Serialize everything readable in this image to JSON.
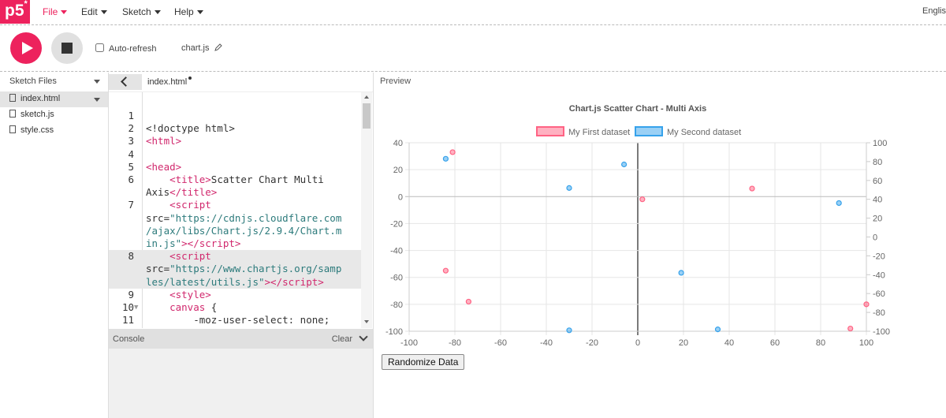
{
  "nav": {
    "logo": "p5",
    "logo_sup": "*",
    "menus": [
      "File",
      "Edit",
      "Sketch",
      "Help"
    ],
    "language": "Englis"
  },
  "toolbar": {
    "auto_refresh_label": "Auto-refresh",
    "sketch_name": "chart.js"
  },
  "sidebar": {
    "title": "Sketch Files",
    "files": [
      "index.html",
      "sketch.js",
      "style.css"
    ]
  },
  "editor": {
    "tab_file": "index.html"
  },
  "console": {
    "title": "Console",
    "clear_label": "Clear"
  },
  "preview": {
    "label": "Preview",
    "randomize_label": "Randomize Data"
  },
  "colors": {
    "accent": "#ed225d",
    "dataset1": "#ff6384",
    "dataset2": "#36a2eb"
  },
  "chart_data": {
    "type": "scatter",
    "title": "Chart.js Scatter Chart - Multi Axis",
    "legend_position": "top",
    "grid": true,
    "x_axis": {
      "min": -100,
      "max": 100,
      "ticks": [
        "-100",
        "-80",
        "-60",
        "-40",
        "-20",
        "0",
        "20",
        "40",
        "60",
        "80",
        "100"
      ]
    },
    "y_left": {
      "min": -100,
      "max": 40,
      "ticks": [
        "40",
        "20",
        "0",
        "-20",
        "-40",
        "-60",
        "-80",
        "-100"
      ]
    },
    "y_right": {
      "min": -100,
      "max": 100,
      "ticks": [
        "100",
        "80",
        "60",
        "40",
        "20",
        "0",
        "-20",
        "-40",
        "-60",
        "-80",
        "-100"
      ]
    },
    "series": [
      {
        "name": "My First dataset",
        "axis": "left",
        "points": [
          [
            -81,
            33
          ],
          [
            -84,
            -55
          ],
          [
            -74,
            -78
          ],
          [
            2,
            -2
          ],
          [
            50,
            6
          ],
          [
            93,
            -98
          ],
          [
            100,
            -80
          ]
        ]
      },
      {
        "name": "My Second dataset",
        "axis": "right",
        "points": [
          [
            -84,
            83
          ],
          [
            -6,
            77
          ],
          [
            -30,
            52
          ],
          [
            88,
            36
          ],
          [
            19,
            -38
          ],
          [
            -30,
            -99
          ],
          [
            35,
            -98
          ]
        ]
      }
    ]
  },
  "code_lines": [
    {
      "n": "1",
      "hl": false,
      "html": ""
    },
    {
      "n": "2",
      "hl": false,
      "html": "&lt;!doctype html&gt;"
    },
    {
      "n": "3",
      "hl": false,
      "html": "<span class=\"t\">&lt;html&gt;</span>"
    },
    {
      "n": "4",
      "hl": false,
      "html": ""
    },
    {
      "n": "5",
      "hl": false,
      "html": "<span class=\"t\">&lt;head&gt;</span>"
    },
    {
      "n": "6",
      "hl": false,
      "html": "    <span class=\"t\">&lt;title&gt;</span>Scatter Chart Multi"
    },
    {
      "n": "",
      "hl": false,
      "html": "Axis<span class=\"t\">&lt;/title&gt;</span>"
    },
    {
      "n": "7",
      "hl": false,
      "html": "    <span class=\"t\">&lt;script</span>"
    },
    {
      "n": "",
      "hl": false,
      "html": "src=<span class=\"s\">\"https://cdnjs.cloudflare.com</span>"
    },
    {
      "n": "",
      "hl": false,
      "html": "<span class=\"s\">/ajax/libs/Chart.js/2.9.4/Chart.m</span>"
    },
    {
      "n": "",
      "hl": false,
      "html": "<span class=\"s\">in.js\"</span><span class=\"t\">&gt;&lt;/script&gt;</span>"
    },
    {
      "n": "8",
      "hl": true,
      "html": "    <span class=\"t\">&lt;script</span>"
    },
    {
      "n": "",
      "hl": true,
      "html": "src=<span class=\"s\">\"https://www.chartjs.org/samp</span>"
    },
    {
      "n": "",
      "hl": true,
      "html": "<span class=\"s\">les/latest/utils.js\"</span><span class=\"t\">&gt;&lt;/script&gt;</span>"
    },
    {
      "n": "9",
      "hl": false,
      "html": "    <span class=\"t\">&lt;style&gt;</span>"
    },
    {
      "n": "10",
      "hl": false,
      "fold": true,
      "html": "    <span class=\"t\">canvas</span> {"
    },
    {
      "n": "11",
      "hl": false,
      "html": "        -moz-user-select: none;"
    }
  ]
}
